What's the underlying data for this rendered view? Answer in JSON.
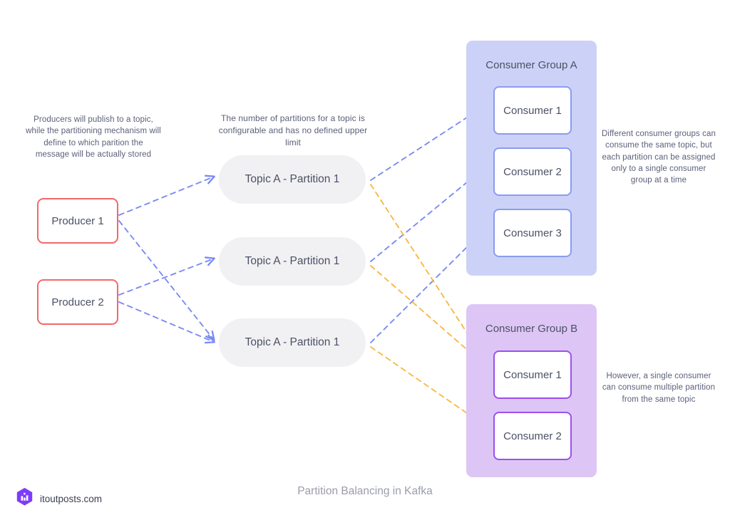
{
  "caption": "Partition Balancing in Kafka",
  "brand": {
    "name": "itoutposts.com",
    "logo_icon": "hexagon-logo-icon"
  },
  "notes": {
    "producers": "Producers will publish to a topic, while the partitioning mechanism will define to which parition the message will be actually stored",
    "partitions": "The number of partitions for a topic is configurable and has no defined upper limit",
    "groups": "Different consumer groups can consume the same topic, but each partition can be assigned only to a single consumer group at a time",
    "single_consumer": "However, a single consumer can consume multiple partition from the same topic"
  },
  "producers": [
    {
      "label": "Producer 1"
    },
    {
      "label": "Producer 2"
    }
  ],
  "topics": [
    {
      "label": "Topic A -  Partition 1"
    },
    {
      "label": "Topic A -  Partition 1"
    },
    {
      "label": "Topic A -  Partition 1"
    }
  ],
  "consumer_groups": [
    {
      "title": "Consumer Group A",
      "consumers": [
        {
          "label": "Consumer 1"
        },
        {
          "label": "Consumer 2"
        },
        {
          "label": "Consumer 3"
        }
      ]
    },
    {
      "title": "Consumer Group B",
      "consumers": [
        {
          "label": "Consumer 1"
        },
        {
          "label": "Consumer 2"
        }
      ]
    }
  ],
  "colors": {
    "producer_border": "#f4676b",
    "topic_fill": "#f1f1f3",
    "group_a_fill": "#ccd2f7",
    "group_b_fill": "#ddc6f5",
    "consumer_a_border": "#8b9bf0",
    "consumer_b_border": "#9b4ff0",
    "arrow_blue": "#7b8bf5",
    "arrow_orange": "#f8b943",
    "text": "#4c5066",
    "note_text": "#5b5f79",
    "caption_text": "#9a9cad",
    "logo_purple": "#7d3cf8"
  },
  "edges": {
    "producer_to_topic": [
      {
        "from": "Producer 1",
        "to": "Topic 1",
        "color": "#7b8bf5"
      },
      {
        "from": "Producer 1",
        "to": "Topic 3",
        "color": "#7b8bf5"
      },
      {
        "from": "Producer 2",
        "to": "Topic 2",
        "color": "#7b8bf5"
      },
      {
        "from": "Producer 2",
        "to": "Topic 3",
        "color": "#7b8bf5"
      }
    ],
    "topic_to_consumer": [
      {
        "from": "Topic 1",
        "to": "Consumer Group A / Consumer 1",
        "color": "#7b8bf5"
      },
      {
        "from": "Topic 2",
        "to": "Consumer Group A / Consumer 2",
        "color": "#7b8bf5"
      },
      {
        "from": "Topic 3",
        "to": "Consumer Group A / Consumer 3",
        "color": "#7b8bf5"
      },
      {
        "from": "Topic 1",
        "to": "Consumer Group B / Consumer 1",
        "color": "#f8b943"
      },
      {
        "from": "Topic 2",
        "to": "Consumer Group B / Consumer 1",
        "color": "#f8b943"
      },
      {
        "from": "Topic 3",
        "to": "Consumer Group B / Consumer 2",
        "color": "#f8b943"
      }
    ]
  }
}
